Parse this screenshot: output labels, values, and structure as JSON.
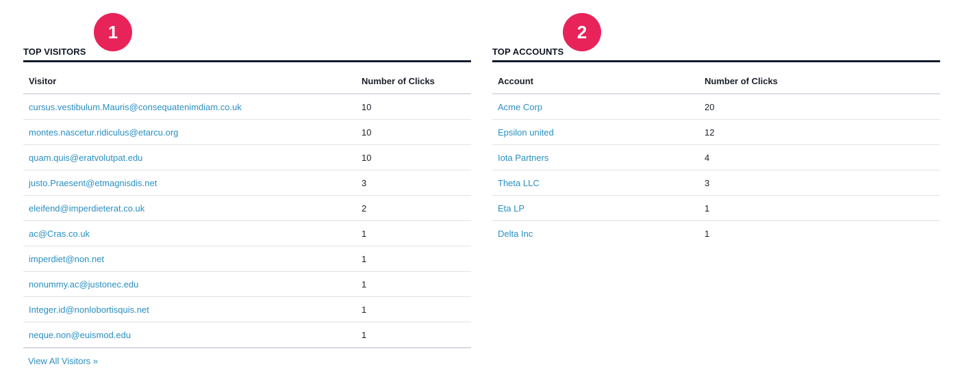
{
  "colors": {
    "badge": "#e8235a",
    "link": "#2a8fc1",
    "rule": "#0e1a2b"
  },
  "visitors": {
    "badge": "1",
    "title": "TOP VISITORS",
    "columns": [
      "Visitor",
      "Number of Clicks"
    ],
    "rows": [
      {
        "name": "cursus.vestibulum.Mauris@consequatenimdiam.co.uk",
        "clicks": "10"
      },
      {
        "name": "montes.nascetur.ridiculus@etarcu.org",
        "clicks": "10"
      },
      {
        "name": "quam.quis@eratvolutpat.edu",
        "clicks": "10"
      },
      {
        "name": "justo.Praesent@etmagnisdis.net",
        "clicks": "3"
      },
      {
        "name": "eleifend@imperdieterat.co.uk",
        "clicks": "2"
      },
      {
        "name": "ac@Cras.co.uk",
        "clicks": "1"
      },
      {
        "name": "imperdiet@non.net",
        "clicks": "1"
      },
      {
        "name": "nonummy.ac@justonec.edu",
        "clicks": "1"
      },
      {
        "name": "Integer.id@nonlobortisquis.net",
        "clicks": "1"
      },
      {
        "name": "neque.non@euismod.edu",
        "clicks": "1"
      }
    ],
    "view_all": "View All Visitors »"
  },
  "accounts": {
    "badge": "2",
    "title": "TOP ACCOUNTS",
    "columns": [
      "Account",
      "Number of Clicks"
    ],
    "rows": [
      {
        "name": "Acme Corp",
        "clicks": "20"
      },
      {
        "name": "Epsilon united",
        "clicks": "12"
      },
      {
        "name": "Iota Partners",
        "clicks": "4"
      },
      {
        "name": "Theta LLC",
        "clicks": "3"
      },
      {
        "name": "Eta LP",
        "clicks": "1"
      },
      {
        "name": "Delta Inc",
        "clicks": "1"
      }
    ]
  }
}
